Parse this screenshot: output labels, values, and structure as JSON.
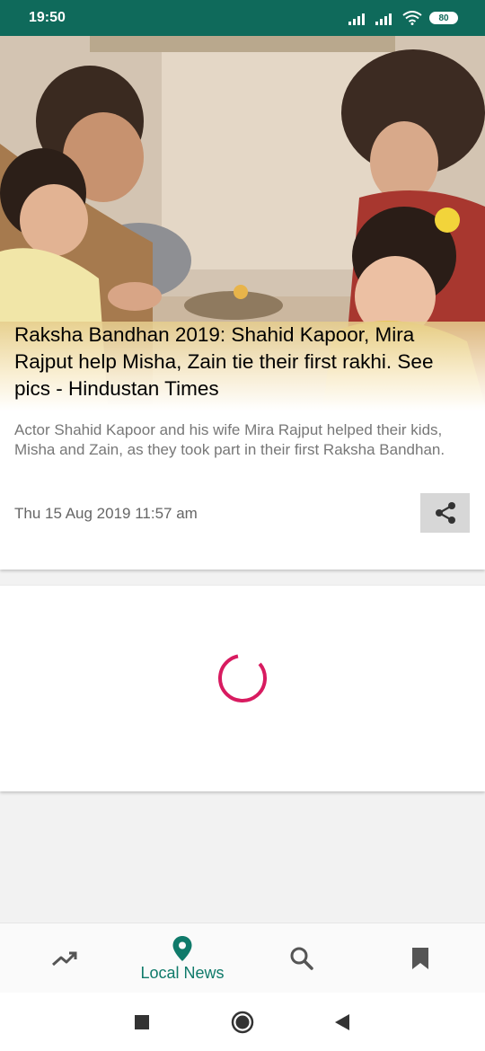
{
  "status_bar": {
    "time": "19:50",
    "battery": "80"
  },
  "article": {
    "title": "Raksha Bandhan 2019: Shahid Kapoor, Mira Rajput help Misha, Zain tie their first rakhi. See pics - Hindustan Times",
    "summary": "Actor Shahid Kapoor and his wife Mira Rajput helped their kids, Misha and Zain, as they took part in their first Raksha Bandhan.",
    "date": "Thu 15 Aug 2019 11:57 am"
  },
  "colors": {
    "status_bar": "#0f6a5b",
    "accent": "#0f7a6a",
    "spinner": "#d81b60"
  },
  "bottom_nav": {
    "items": [
      {
        "icon": "trending-icon",
        "label": ""
      },
      {
        "icon": "location-pin-icon",
        "label": "Local News"
      },
      {
        "icon": "search-icon",
        "label": ""
      },
      {
        "icon": "bookmark-icon",
        "label": ""
      }
    ]
  },
  "system_nav": {
    "items": [
      "recent-apps-icon",
      "home-icon",
      "back-icon"
    ]
  }
}
